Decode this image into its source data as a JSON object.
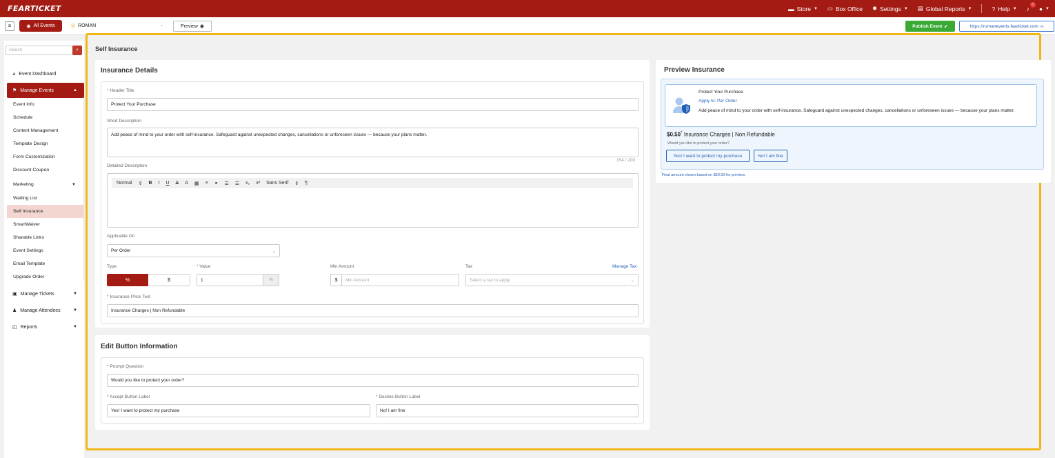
{
  "topbar": {
    "logo": "FEARTICKET",
    "nav": [
      {
        "label": "Store",
        "icon": "store-icon"
      },
      {
        "label": "Box Office",
        "icon": "monitor-icon"
      },
      {
        "label": "Settings",
        "icon": "gear-icon"
      },
      {
        "label": "Global Reports",
        "icon": "report-icon"
      },
      {
        "label": "Help",
        "icon": "question-icon"
      }
    ],
    "notification_count": "0"
  },
  "subbar": {
    "all_events": "All Events",
    "event_name": "ROMAN",
    "preview": "Preview",
    "publish": "Publish Event",
    "url": "https://romanevents.fearticket.com"
  },
  "sidebar": {
    "search_placeholder": "Search",
    "event_dashboard": "Event Dashboard",
    "manage_events": "Manage Events",
    "links": [
      "Event Info",
      "Schedule",
      "Content Management",
      "Template Design",
      "Form Customization",
      "Discount Coupon",
      "Marketing",
      "Waiting List",
      "Self Insurance",
      "SmartWaiver",
      "Sharable Links",
      "Event Settings",
      "Email Template",
      "Upgrade Order"
    ],
    "manage_tickets": "Manage Tickets",
    "manage_attendees": "Manage Attendees",
    "reports": "Reports"
  },
  "page": {
    "title": "Self Insurance"
  },
  "details": {
    "title": "Insurance Details",
    "header_title_label": "Header Title",
    "header_title_value": "Protect Your Purchase",
    "short_desc_label": "Short Description",
    "short_desc_value": "Add peace of mind to your order with self-insurance. Safeguard against unexpected changes, cancellations or unforeseen issues — because your plans matter.",
    "char_count": "154 / 200",
    "detailed_desc_label": "Detailed Description",
    "toolbar": {
      "format": "Normal",
      "font": "Sans Serif"
    },
    "applicable_label": "Applicable On",
    "applicable_value": "Per Order",
    "type_label": "Type",
    "type_percent": "%",
    "type_dollar": "$",
    "value_label": "Value",
    "value_value": "1",
    "value_unit": "%",
    "min_label": "Min Amount",
    "min_currency": "$",
    "min_placeholder": "Min Amount",
    "tax_label": "Tax",
    "tax_placeholder": "Select a tax to apply",
    "manage_tax": "Manage Tax",
    "price_text_label": "Insurance Price Text",
    "price_text_value": "Insurance Charges | Non Refundable"
  },
  "buttons": {
    "title": "Edit Button Information",
    "prompt_label": "Prompt Question",
    "prompt_value": "Would you like to protect your order?",
    "accept_label": "Accept Button Label",
    "accept_value": "Yes! I want to protect my purchase",
    "decline_label": "Decline Button Label",
    "decline_value": "No! I am fine"
  },
  "preview": {
    "title": "Preview Insurance",
    "heading": "Protect Your Purchase",
    "apply_to": "Apply to: Per Order",
    "desc": "Add peace of mind to your order with self-insurance. Safeguard against unexpected changes, cancellations or unforeseen issues — because your plans matter.",
    "price": "$0.50",
    "price_text": "Insurance Charges | Non Refundable",
    "question": "Would you like to protect your order?",
    "accept": "Yes! I want to protect my purchase",
    "decline": "No! I am fine",
    "footnote": "Final amount shown based on $50.00 for preview."
  },
  "colors": {
    "brand": "#a31b13",
    "publish": "#3aaa35",
    "link": "#2a62b8",
    "highlight": "#f1b715"
  }
}
